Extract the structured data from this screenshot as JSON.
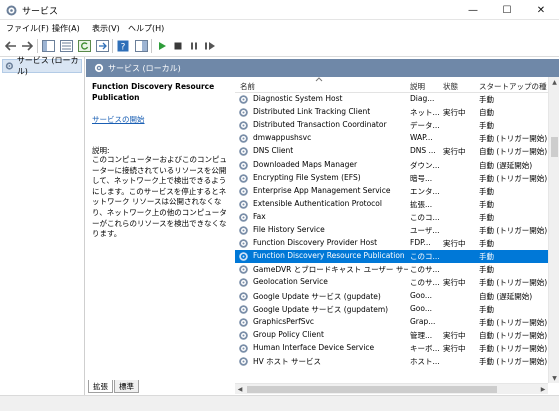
{
  "window": {
    "title": "サービス",
    "minimize_glyph": "—",
    "maximize_glyph": "☐",
    "close_glyph": "✕"
  },
  "menu": {
    "items": [
      "ファイル(F)",
      "操作(A)",
      "表示(V)",
      "ヘルプ(H)"
    ]
  },
  "tree": {
    "root_label": "サービス (ローカル)"
  },
  "pane": {
    "title": "サービス (ローカル)"
  },
  "details": {
    "service_name": "Function Discovery Resource Publication",
    "start_link": "サービスの開始",
    "description_label": "説明:",
    "description": "このコンピューターおよびこのコンピューターに接続されているリソースを公開して、ネットワーク上で検出できるようにします。このサービスを停止するとネットワーク リソースは公開されなくなり、ネットワーク上の他のコンピューターがこれらのリソースを検出できなくなります。"
  },
  "columns": {
    "name": "名前",
    "description": "説明",
    "status": "状態",
    "startup": "スタートアップの種類"
  },
  "services": [
    {
      "name": "Diagnostic System Host",
      "desc": "Diag...",
      "status": "",
      "startup": "手動"
    },
    {
      "name": "Distributed Link Tracking Client",
      "desc": "ネット...",
      "status": "実行中",
      "startup": "自動"
    },
    {
      "name": "Distributed Transaction Coordinator",
      "desc": "データ...",
      "status": "",
      "startup": "手動"
    },
    {
      "name": "dmwappushsvc",
      "desc": "WAP...",
      "status": "",
      "startup": "手動 (トリガー開始)"
    },
    {
      "name": "DNS Client",
      "desc": "DNS ...",
      "status": "実行中",
      "startup": "自動 (トリガー開始)"
    },
    {
      "name": "Downloaded Maps Manager",
      "desc": "ダウン...",
      "status": "",
      "startup": "自動 (遅延開始)"
    },
    {
      "name": "Encrypting File System (EFS)",
      "desc": "暗号...",
      "status": "",
      "startup": "手動 (トリガー開始)"
    },
    {
      "name": "Enterprise App Management Service",
      "desc": "エンタ...",
      "status": "",
      "startup": "手動"
    },
    {
      "name": "Extensible Authentication Protocol",
      "desc": "拡張...",
      "status": "",
      "startup": "手動"
    },
    {
      "name": "Fax",
      "desc": "このコ...",
      "status": "",
      "startup": "手動"
    },
    {
      "name": "File History Service",
      "desc": "ユーザ...",
      "status": "",
      "startup": "手動 (トリガー開始)"
    },
    {
      "name": "Function Discovery Provider Host",
      "desc": "FDP...",
      "status": "実行中",
      "startup": "手動"
    },
    {
      "name": "Function Discovery Resource Publication",
      "desc": "このコ...",
      "status": "",
      "startup": "手動",
      "selected": true
    },
    {
      "name": "GameDVR とブロードキャスト ユーザー サービス...",
      "desc": "このサ...",
      "status": "",
      "startup": "手動"
    },
    {
      "name": "Geolocation Service",
      "desc": "このサ...",
      "status": "実行中",
      "startup": "手動 (トリガー開始)"
    },
    {
      "name": "Google Update サービス (gupdate)",
      "desc": "Goo...",
      "status": "",
      "startup": "自動 (遅延開始)"
    },
    {
      "name": "Google Update サービス (gupdatem)",
      "desc": "Goo...",
      "status": "",
      "startup": "手動"
    },
    {
      "name": "GraphicsPerfSvc",
      "desc": "Grap...",
      "status": "",
      "startup": "手動 (トリガー開始)"
    },
    {
      "name": "Group Policy Client",
      "desc": "管理...",
      "status": "実行中",
      "startup": "自動 (トリガー開始)"
    },
    {
      "name": "Human Interface Device Service",
      "desc": "キーボ...",
      "status": "実行中",
      "startup": "手動 (トリガー開始)"
    },
    {
      "name": "HV ホスト サービス",
      "desc": "ホスト...",
      "status": "",
      "startup": "手動 (トリガー開始)"
    }
  ],
  "tabs": [
    "拡張",
    "標準"
  ],
  "colors": {
    "pane_header": "#6f88a8",
    "selection": "#0078d7",
    "tree_selected": "#d9e5f3",
    "link": "#1a5fb4"
  }
}
